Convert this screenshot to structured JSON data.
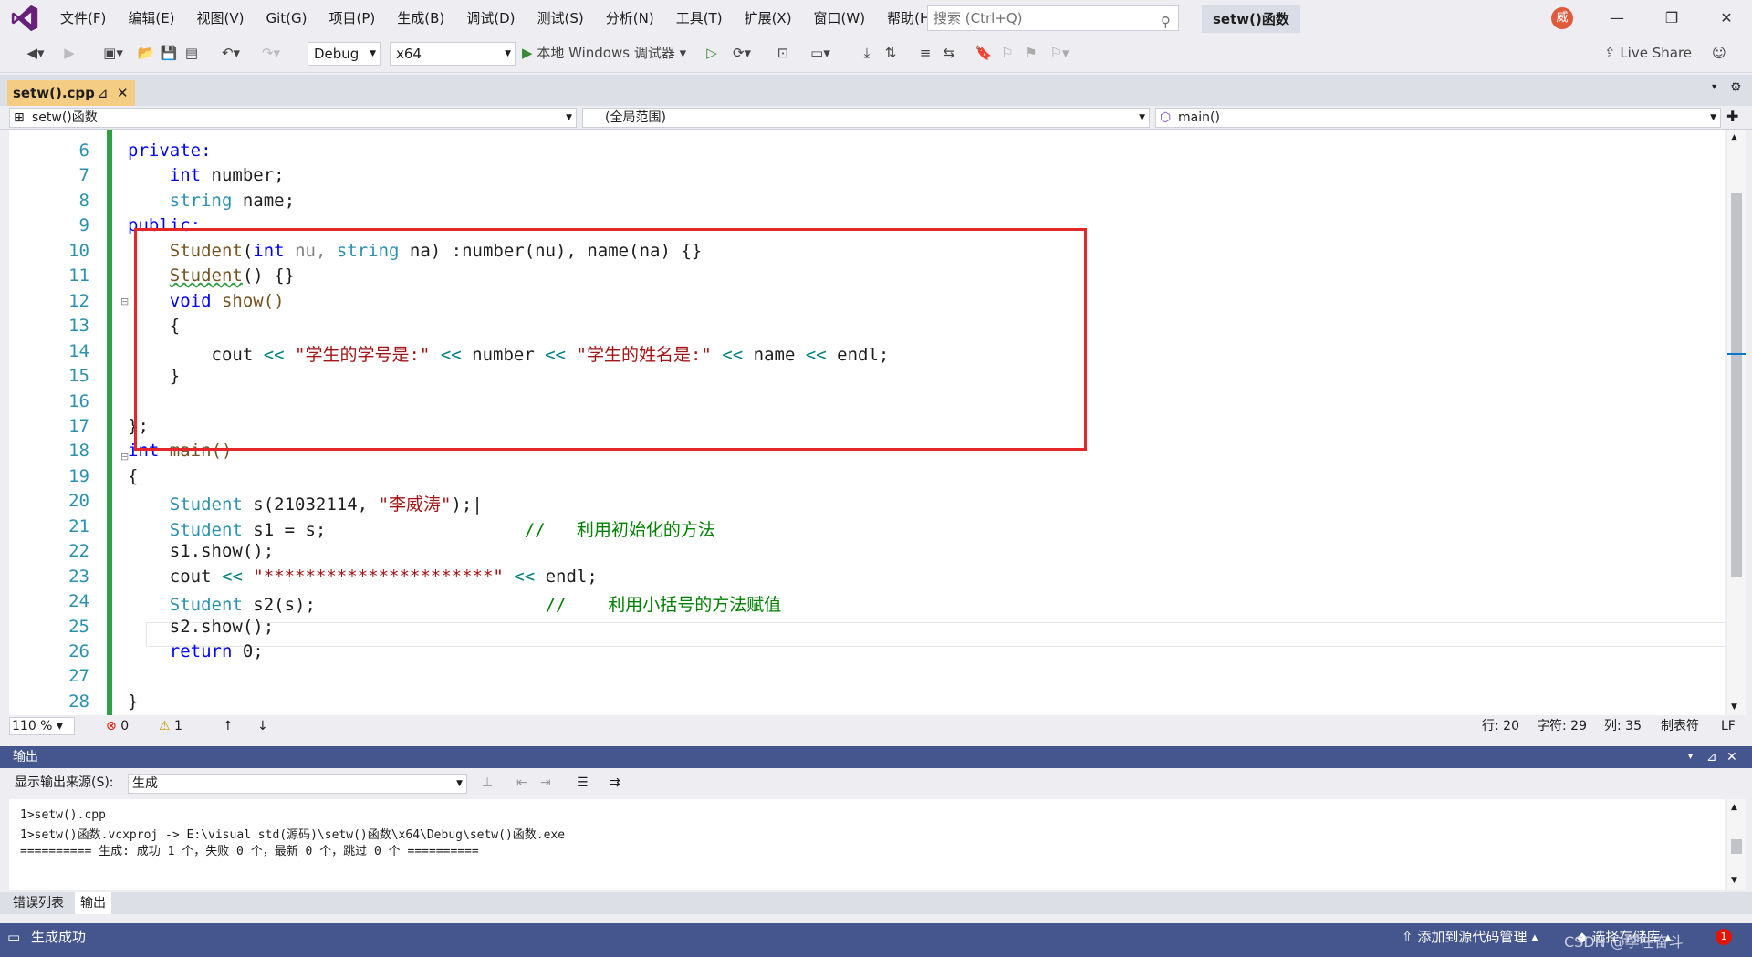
{
  "menu": [
    "文件(F)",
    "编辑(E)",
    "视图(V)",
    "Git(G)",
    "项目(P)",
    "生成(B)",
    "调试(D)",
    "测试(S)",
    "分析(N)",
    "工具(T)",
    "扩展(X)",
    "窗口(W)",
    "帮助(H)"
  ],
  "search_placeholder": "搜索 (Ctrl+Q)",
  "solution_title": "setw()函数",
  "avatar_text": "威",
  "toolbar": {
    "config": "Debug",
    "platform": "x64",
    "debugger": "本地 Windows 调试器",
    "live_share": "Live Share"
  },
  "tab": {
    "label": "setw().cpp",
    "pin": "⊿",
    "close": "✕"
  },
  "nav": {
    "project": "setw()函数",
    "scope": "(全局范围)",
    "member": "main()"
  },
  "line_numbers": [
    "6",
    "7",
    "8",
    "9",
    "10",
    "11",
    "12",
    "13",
    "14",
    "15",
    "16",
    "17",
    "18",
    "19",
    "20",
    "21",
    "22",
    "23",
    "24",
    "25",
    "26",
    "27",
    "28"
  ],
  "code": {
    "l6": "private:",
    "l7_kw": "int",
    "l7_rest": " number;",
    "l8_ty": "string",
    "l8_rest": " name;",
    "l9": "public:",
    "l10_a": "Student",
    "l10_b": "(",
    "l10_c": "int",
    "l10_d": " nu, ",
    "l10_e": "string",
    "l10_f": " na) :number(nu), name(na) {}",
    "l11_a": "Student",
    "l11_b": "() {}",
    "l12_a": "void",
    "l12_b": " show()",
    "l13": "{",
    "l14_a": "cout ",
    "l14_b": "<<",
    "l14_c": " \"学生的学号是:\" ",
    "l14_d": "<<",
    "l14_e": " number ",
    "l14_f": "<<",
    "l14_g": " \"学生的姓名是:\" ",
    "l14_h": "<<",
    "l14_i": " name ",
    "l14_j": "<<",
    "l14_k": " endl;",
    "l15": "}",
    "l17": "};",
    "l18_a": "int",
    "l18_b": " main()",
    "l19": "{",
    "l20_a": "Student",
    "l20_b": " s(21032114, ",
    "l20_c": "\"李威涛\"",
    "l20_d": ");",
    "l21_a": "Student",
    "l21_b": " s1 = s;",
    "l21_c": "//   利用初始化的方法",
    "l22": "s1.show();",
    "l23_a": "cout ",
    "l23_b": "<<",
    "l23_c": " \"**********************\" ",
    "l23_d": "<<",
    "l23_e": " endl;",
    "l24_a": "Student",
    "l24_b": " s2(s);",
    "l24_c": "//    利用小括号的方法赋值",
    "l25": "s2.show();",
    "l26_a": "return",
    "l26_b": " 0;",
    "l28": "}"
  },
  "status": {
    "zoom": "110 %",
    "errors": "0",
    "warnings": "1",
    "row": "行: 20",
    "char": "字符: 29",
    "col": "列: 35",
    "tab": "制表符",
    "eol": "LF"
  },
  "output": {
    "title": "输出",
    "source_label": "显示输出来源(S):",
    "source_value": "生成",
    "lines": [
      "1>setw().cpp",
      "1>setw()函数.vcxproj -> E:\\visual std(源码)\\setw()函数\\x64\\Debug\\setw()函数.exe",
      "========== 生成: 成功 1 个，失败 0 个，最新 0 个，跳过 0 个 =========="
    ]
  },
  "bottom_tabs": [
    "错误列表",
    "输出"
  ],
  "statusbar": {
    "left": "生成成功",
    "source_control": "添加到源代码管理",
    "repo": "选择存储库",
    "watermark": "CSDN @李在奋斗",
    "notif": "1"
  },
  "colors": {
    "accent": "#44568d",
    "redbox": "#e5262b",
    "keyword": "#0000ff",
    "type": "#2b91af",
    "string": "#a31515",
    "comment": "#008000"
  }
}
